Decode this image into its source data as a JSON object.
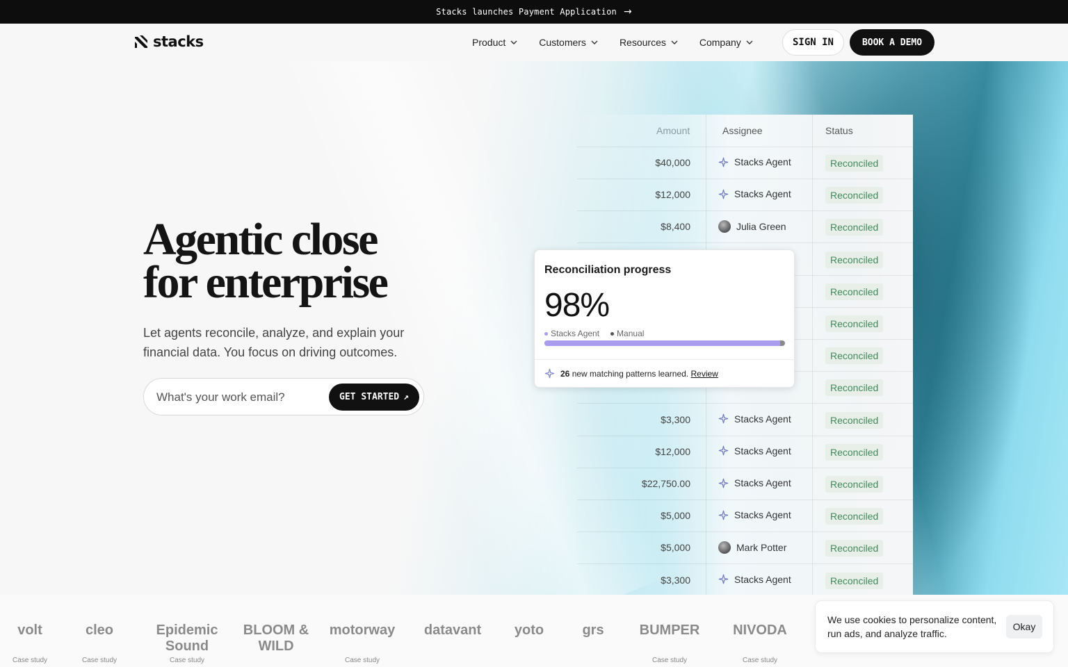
{
  "announcement": {
    "text": "Stacks launches Payment Application",
    "arrow": "→"
  },
  "brand": {
    "name": "stacks"
  },
  "nav": {
    "items": [
      "Product",
      "Customers",
      "Resources",
      "Company"
    ],
    "sign_in": "SIGN IN",
    "book_demo": "BOOK A DEMO"
  },
  "hero": {
    "headline_line1": "Agentic close",
    "headline_line2": "for enterprise",
    "subhead": "Let agents reconcile, analyze, and explain your financial data. You focus on driving outcomes.",
    "email_placeholder": "What's your work email?",
    "cta": "GET STARTED",
    "cta_icon": "↗"
  },
  "table": {
    "headers": {
      "amount": "Amount",
      "assignee": "Assignee",
      "status": "Status"
    },
    "rows": [
      {
        "amount": "$40,000",
        "assignee": "Stacks Agent",
        "type": "agent",
        "status": "Reconciled"
      },
      {
        "amount": "$12,000",
        "assignee": "Stacks Agent",
        "type": "agent",
        "status": "Reconciled"
      },
      {
        "amount": "$8,400",
        "assignee": "Julia Green",
        "type": "person",
        "status": "Reconciled"
      },
      {
        "amount": "",
        "assignee": "",
        "type": "hidden",
        "status": "Reconciled"
      },
      {
        "amount": "",
        "assignee": "",
        "type": "hidden",
        "status": "Reconciled"
      },
      {
        "amount": "",
        "assignee": "",
        "type": "hidden",
        "status": "Reconciled"
      },
      {
        "amount": "",
        "assignee": "",
        "type": "hidden",
        "status": "Reconciled"
      },
      {
        "amount": "",
        "assignee": "",
        "type": "hidden",
        "status": "Reconciled"
      },
      {
        "amount": "$3,300",
        "assignee": "Stacks Agent",
        "type": "agent",
        "status": "Reconciled"
      },
      {
        "amount": "$12,000",
        "assignee": "Stacks Agent",
        "type": "agent",
        "status": "Reconciled"
      },
      {
        "amount": "$22,750.00",
        "assignee": "Stacks Agent",
        "type": "agent",
        "status": "Reconciled"
      },
      {
        "amount": "$5,000",
        "assignee": "Stacks Agent",
        "type": "agent",
        "status": "Reconciled"
      },
      {
        "amount": "$5,000",
        "assignee": "Mark Potter",
        "type": "person",
        "status": "Reconciled"
      },
      {
        "amount": "$3,300",
        "assignee": "Stacks Agent",
        "type": "agent",
        "status": "Reconciled"
      }
    ]
  },
  "progress_card": {
    "title": "Reconciliation progress",
    "percent_label": "98%",
    "agent_fraction": 0.98,
    "legend_agent": "Stacks Agent",
    "legend_manual": "Manual",
    "agent_color": "#a99cef",
    "manual_color": "#8a8a8a",
    "patterns_count": "26",
    "patterns_text": "new matching patterns learned.",
    "review_link": "Review"
  },
  "logos": [
    {
      "name": "volt",
      "case": "Case study"
    },
    {
      "name": "cleo",
      "case": "Case study"
    },
    {
      "name": "Epidemic Sound",
      "case": "Case study"
    },
    {
      "name": "BLOOM & WILD",
      "case": ""
    },
    {
      "name": "motorway",
      "case": "Case study"
    },
    {
      "name": "datavant",
      "case": ""
    },
    {
      "name": "yoto",
      "case": ""
    },
    {
      "name": "grs",
      "case": ""
    },
    {
      "name": "BUMPER",
      "case": "Case study"
    },
    {
      "name": "NIVODA",
      "case": "Case study"
    }
  ],
  "cookie": {
    "text": "We use cookies to personalize content, run ads, and analyze traffic.",
    "okay": "Okay"
  }
}
